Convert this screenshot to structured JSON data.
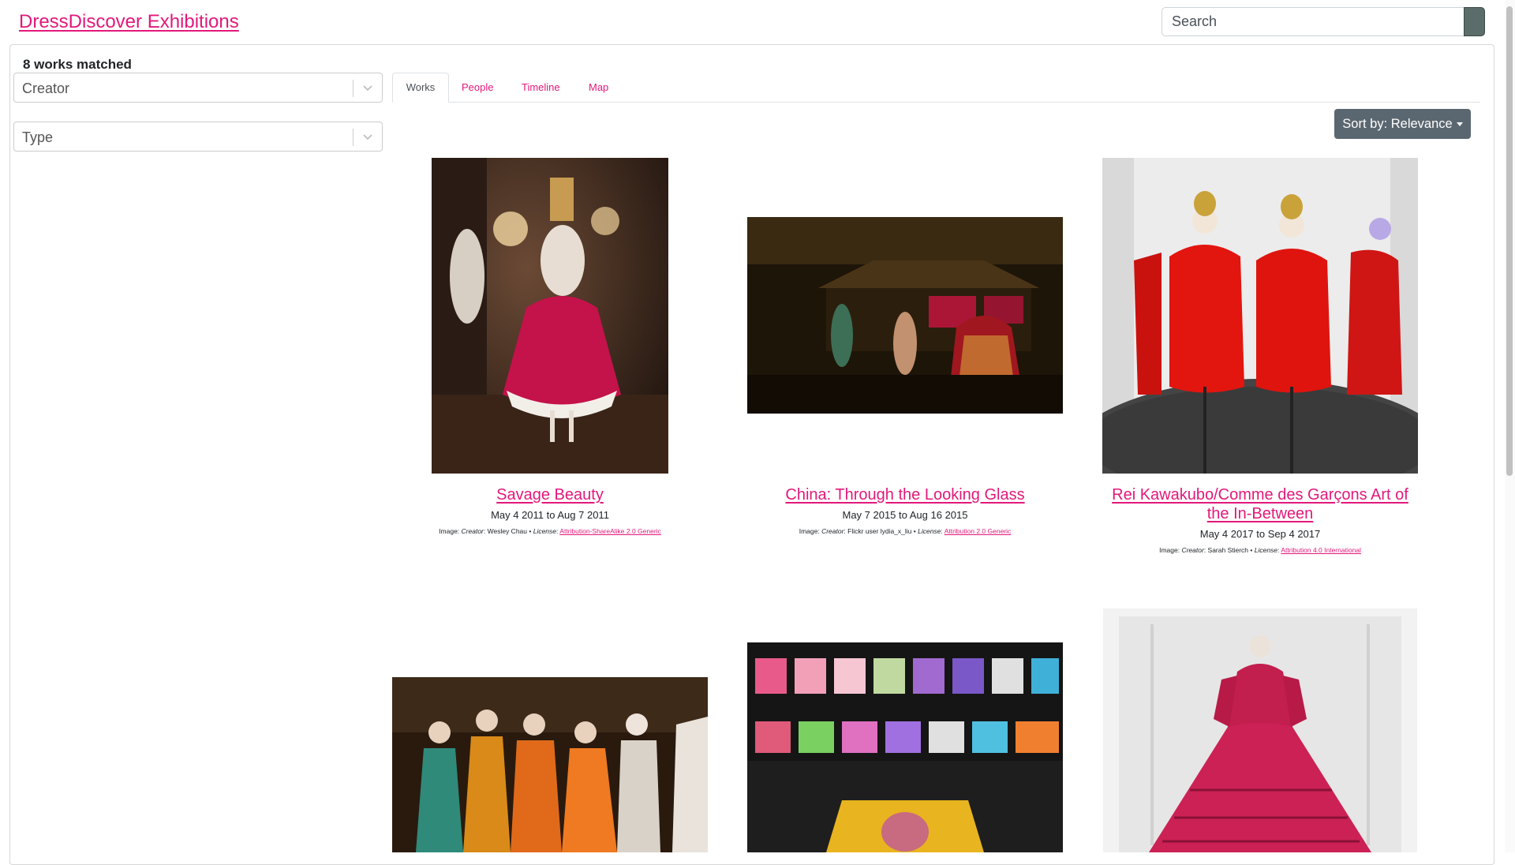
{
  "header": {
    "brand": "DressDiscover Exhibitions",
    "search_placeholder": "Search"
  },
  "sidebar": {
    "results_count": "8 works matched",
    "filters": [
      {
        "placeholder": "Creator"
      },
      {
        "placeholder": "Type"
      }
    ]
  },
  "tabs": [
    {
      "label": "Works",
      "active": true
    },
    {
      "label": "People",
      "active": false
    },
    {
      "label": "Timeline",
      "active": false
    },
    {
      "label": "Map",
      "active": false
    }
  ],
  "sort": {
    "label": "Sort by: Relevance"
  },
  "works": [
    {
      "title": "Savage Beauty",
      "dates": "May 4 2011 to Aug 7 2011",
      "credit": {
        "creator_label": "Creator",
        "creator": "Wesley Chau",
        "license_label": "License",
        "license": "Attribution-ShareAlike 2.0 Generic"
      }
    },
    {
      "title": "China: Through the Looking Glass",
      "dates": "May 7 2015 to Aug 16 2015",
      "credit": {
        "creator_label": "Creator",
        "creator": "Flickr user lydia_x_liu",
        "license_label": "License",
        "license": "Attribution 2.0 Generic"
      }
    },
    {
      "title": "Rei Kawakubo/Comme des Garçons Art of the In-Between",
      "dates": "May 4 2017 to Sep 4 2017",
      "credit": {
        "creator_label": "Creator",
        "creator": "Sarah Stierch",
        "license_label": "License",
        "license": "Attribution 4.0 International"
      }
    }
  ],
  "colors": {
    "accent": "#e3187a",
    "sort_button": "#5b6770",
    "search_button": "#5b6d6a"
  }
}
